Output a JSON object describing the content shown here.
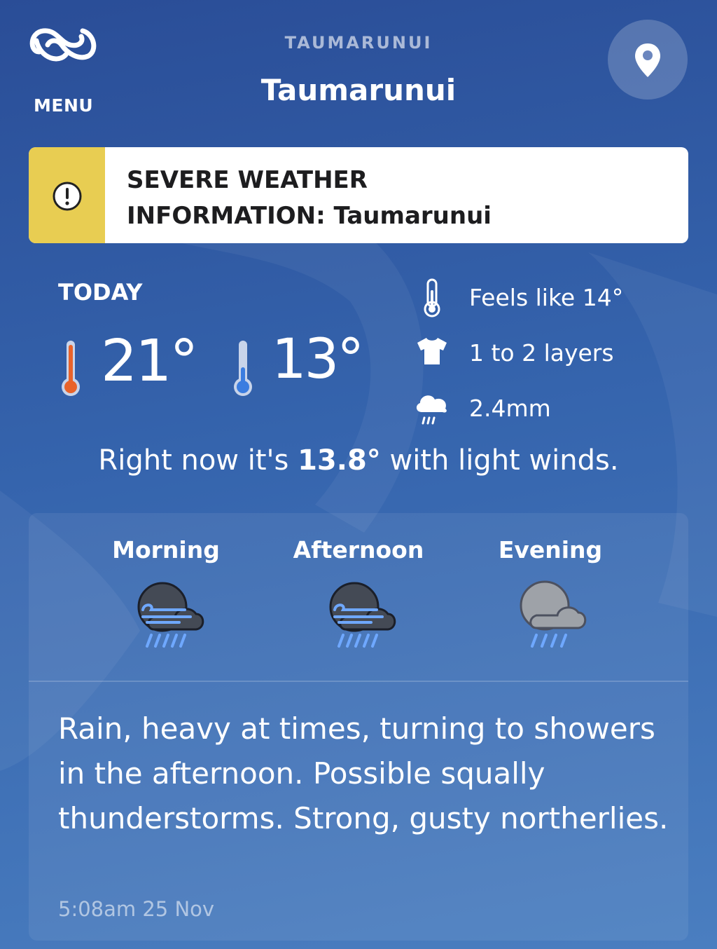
{
  "header": {
    "menu_label": "MENU",
    "location_small": "TAUMARUNUI",
    "location_title": "Taumarunui"
  },
  "warning": {
    "line1": "SEVERE WEATHER",
    "line2": "INFORMATION: Taumarunui",
    "accent_color": "#e8cd52"
  },
  "today": {
    "label": "TODAY",
    "high": "21°",
    "low": "13°",
    "high_color": "#e8632b",
    "low_color": "#3b7de0",
    "feels_like": "Feels like 14°",
    "layers": "1 to 2 layers",
    "rain": "2.4mm",
    "right_now_prefix": "Right now it's ",
    "right_now_temp": "13.8°",
    "right_now_suffix": " with light winds."
  },
  "periods": [
    {
      "label": "Morning",
      "icon": "rain-wind-icon"
    },
    {
      "label": "Afternoon",
      "icon": "rain-wind-icon"
    },
    {
      "label": "Evening",
      "icon": "cloud-rain-icon"
    }
  ],
  "description": "Rain, heavy at times, turning to showers in the afternoon. Possible squally thunderstorms. Strong, gusty northerlies.",
  "timestamp": "5:08am 25 Nov"
}
